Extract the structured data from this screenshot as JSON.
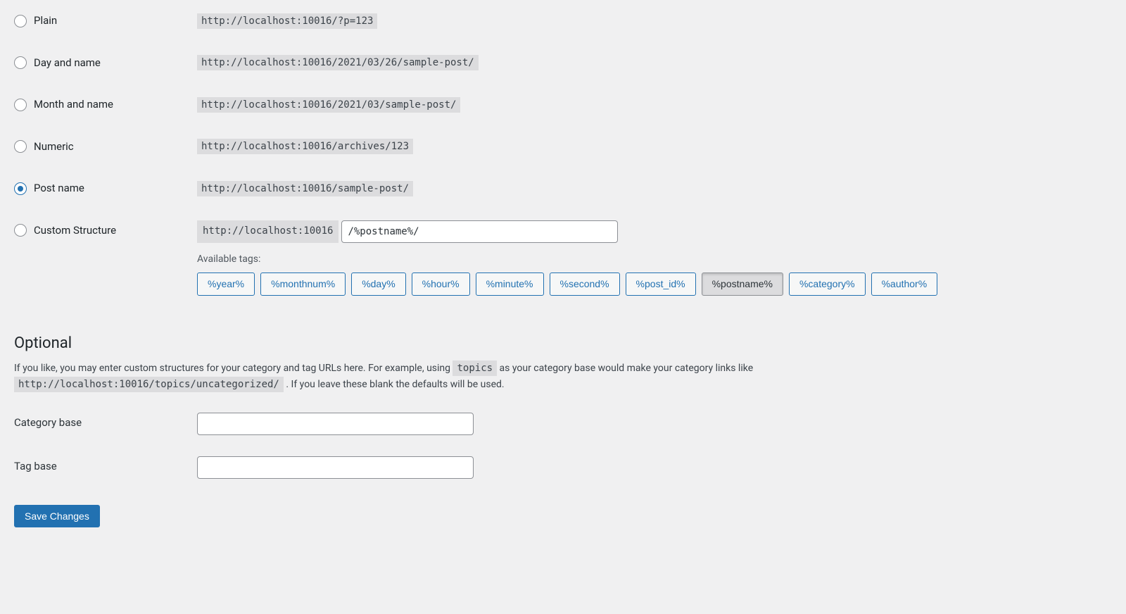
{
  "permalinks": {
    "plain": {
      "label": "Plain",
      "example": "http://localhost:10016/?p=123"
    },
    "dayname": {
      "label": "Day and name",
      "example": "http://localhost:10016/2021/03/26/sample-post/"
    },
    "monthname": {
      "label": "Month and name",
      "example": "http://localhost:10016/2021/03/sample-post/"
    },
    "numeric": {
      "label": "Numeric",
      "example": "http://localhost:10016/archives/123"
    },
    "postname": {
      "label": "Post name",
      "example": "http://localhost:10016/sample-post/"
    },
    "custom": {
      "label": "Custom Structure",
      "prefix": "http://localhost:10016",
      "value": "/%postname%/"
    }
  },
  "availableTagsLabel": "Available tags:",
  "tags": {
    "year": "%year%",
    "monthnum": "%monthnum%",
    "day": "%day%",
    "hour": "%hour%",
    "minute": "%minute%",
    "second": "%second%",
    "post_id": "%post_id%",
    "postname": "%postname%",
    "category": "%category%",
    "author": "%author%"
  },
  "optional": {
    "heading": "Optional",
    "desc1": "If you like, you may enter custom structures for your category and tag URLs here. For example, using ",
    "descCode1": "topics",
    "desc2": " as your category base would make your category links like ",
    "descCode2": "http://localhost:10016/topics/uncategorized/",
    "desc3": " . If you leave these blank the defaults will be used.",
    "categoryLabel": "Category base",
    "tagLabel": "Tag base"
  },
  "save": "Save Changes"
}
